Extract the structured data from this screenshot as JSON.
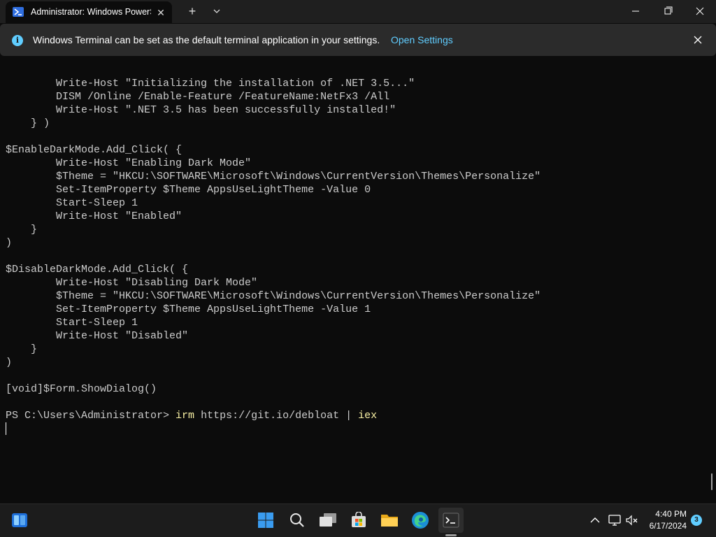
{
  "window": {
    "tab_title": "Administrator: Windows PowerShell",
    "icons": [
      "powershell-icon",
      "close-icon",
      "plus-icon",
      "chevron-down-icon",
      "minimize-icon",
      "maximize-icon",
      "close-icon"
    ]
  },
  "infobar": {
    "message": "Windows Terminal can be set as the default terminal application in your settings.",
    "link_label": "Open Settings"
  },
  "console": {
    "lines": [
      "        Write-Host \"Initializing the installation of .NET 3.5...\"",
      "        DISM /Online /Enable-Feature /FeatureName:NetFx3 /All",
      "        Write-Host \".NET 3.5 has been successfully installed!\"",
      "    } )",
      "",
      "$EnableDarkMode.Add_Click( {",
      "        Write-Host \"Enabling Dark Mode\"",
      "        $Theme = \"HKCU:\\SOFTWARE\\Microsoft\\Windows\\CurrentVersion\\Themes\\Personalize\"",
      "        Set-ItemProperty $Theme AppsUseLightTheme -Value 0",
      "        Start-Sleep 1",
      "        Write-Host \"Enabled\"",
      "    }",
      ")",
      "",
      "$DisableDarkMode.Add_Click( {",
      "        Write-Host \"Disabling Dark Mode\"",
      "        $Theme = \"HKCU:\\SOFTWARE\\Microsoft\\Windows\\CurrentVersion\\Themes\\Personalize\"",
      "        Set-ItemProperty $Theme AppsUseLightTheme -Value 1",
      "        Start-Sleep 1",
      "        Write-Host \"Disabled\"",
      "    }",
      ")",
      "",
      "[void]$Form.ShowDialog()",
      ""
    ],
    "prompt": "PS C:\\Users\\Administrator> ",
    "cmd_irm": "irm",
    "cmd_args": " https://git.io/debloat | ",
    "cmd_iex": "iex"
  },
  "taskbar": {
    "icons": [
      "widgets-icon",
      "start-icon",
      "search-icon",
      "task-view-icon",
      "store-icon",
      "file-explorer-icon",
      "edge-icon",
      "terminal-icon"
    ],
    "tray_icons": [
      "chevron-up-icon",
      "network-icon",
      "volume-muted-icon"
    ],
    "time": "4:40 PM",
    "date": "6/17/2024",
    "notification_count": "3"
  },
  "colors": {
    "background": "#0c0c0c",
    "text": "#cccccc",
    "command": "#f9f1a5",
    "accent": "#60cdff"
  }
}
